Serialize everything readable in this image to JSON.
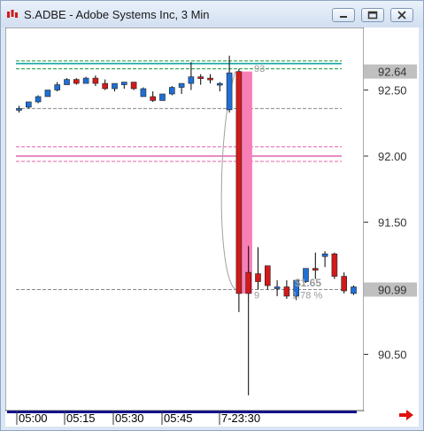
{
  "window": {
    "title": "S.ADBE - Adobe Systems Inc, 3 Min",
    "buttons": [
      "minimize",
      "restore",
      "close"
    ]
  },
  "colors": {
    "up_candle": "#1f6fd6",
    "down_candle": "#d21a1a",
    "highlight_bar": "#f77fb5",
    "teal_level": "#1aa6a6",
    "green_level": "#1a9a3a",
    "pink_level": "#e066b0",
    "gray_level": "#8a8a8a"
  },
  "icons": {
    "app": "candlestick-app-icon",
    "scroll_right": "red-right-arrow-icon"
  },
  "chart_data": {
    "type": "candlestick",
    "y_ticks": [
      "92.50",
      "92.00",
      "91.50",
      "91.00",
      "90.50"
    ],
    "x_ticks": [
      "05:00",
      "05:15",
      "05:30",
      "05:45",
      "7-23:30"
    ],
    "last_price_label": "92.64",
    "current_price_label": "90.99",
    "annotations": {
      "level_label": "93",
      "change_value": "$1.65",
      "change_percent": "1.78 %",
      "left_fragment": "9"
    },
    "candles": [
      {
        "o": 92.36,
        "h": 92.38,
        "l": 92.33,
        "c": 92.36
      },
      {
        "o": 92.37,
        "h": 92.41,
        "l": 92.36,
        "c": 92.41
      },
      {
        "o": 92.41,
        "h": 92.46,
        "l": 92.4,
        "c": 92.45
      },
      {
        "o": 92.45,
        "h": 92.5,
        "l": 92.45,
        "c": 92.5
      },
      {
        "o": 92.5,
        "h": 92.56,
        "l": 92.49,
        "c": 92.54
      },
      {
        "o": 92.54,
        "h": 92.59,
        "l": 92.54,
        "c": 92.58
      },
      {
        "o": 92.58,
        "h": 92.59,
        "l": 92.54,
        "c": 92.55
      },
      {
        "o": 92.55,
        "h": 92.6,
        "l": 92.55,
        "c": 92.59
      },
      {
        "o": 92.59,
        "h": 92.61,
        "l": 92.53,
        "c": 92.55
      },
      {
        "o": 92.55,
        "h": 92.58,
        "l": 92.5,
        "c": 92.51
      },
      {
        "o": 92.51,
        "h": 92.55,
        "l": 92.49,
        "c": 92.55
      },
      {
        "o": 92.54,
        "h": 92.56,
        "l": 92.51,
        "c": 92.56
      },
      {
        "o": 92.56,
        "h": 92.56,
        "l": 92.5,
        "c": 92.51
      },
      {
        "o": 92.45,
        "h": 92.52,
        "l": 92.45,
        "c": 92.51
      },
      {
        "o": 92.45,
        "h": 92.49,
        "l": 92.41,
        "c": 92.42
      },
      {
        "o": 92.42,
        "h": 92.47,
        "l": 92.42,
        "c": 92.47
      },
      {
        "o": 92.47,
        "h": 92.53,
        "l": 92.46,
        "c": 92.52
      },
      {
        "o": 92.52,
        "h": 92.55,
        "l": 92.47,
        "c": 92.55
      },
      {
        "o": 92.55,
        "h": 92.71,
        "l": 92.5,
        "c": 92.6
      },
      {
        "o": 92.6,
        "h": 92.62,
        "l": 92.54,
        "c": 92.59
      },
      {
        "o": 92.59,
        "h": 92.62,
        "l": 92.55,
        "c": 92.58
      },
      {
        "o": 92.54,
        "h": 92.56,
        "l": 92.49,
        "c": 92.55
      },
      {
        "o": 92.35,
        "h": 92.76,
        "l": 92.33,
        "c": 92.63
      },
      {
        "o": 92.64,
        "h": 92.66,
        "l": 90.82,
        "c": 90.96
      },
      {
        "o": 91.12,
        "h": 91.32,
        "l": 90.19,
        "c": 90.96
      },
      {
        "o": 91.11,
        "h": 91.31,
        "l": 90.99,
        "c": 91.05
      },
      {
        "o": 91.17,
        "h": 91.17,
        "l": 90.99,
        "c": 91.02
      },
      {
        "o": 91.0,
        "h": 91.06,
        "l": 90.94,
        "c": 91.01
      },
      {
        "o": 91.01,
        "h": 91.06,
        "l": 90.92,
        "c": 90.94
      },
      {
        "o": 90.94,
        "h": 91.06,
        "l": 90.91,
        "c": 91.06
      },
      {
        "o": 91.05,
        "h": 91.15,
        "l": 91.04,
        "c": 91.15
      },
      {
        "o": 91.15,
        "h": 91.27,
        "l": 91.07,
        "c": 91.14
      },
      {
        "o": 91.24,
        "h": 91.28,
        "l": 91.16,
        "c": 91.26
      },
      {
        "o": 91.26,
        "h": 91.27,
        "l": 91.07,
        "c": 91.09
      },
      {
        "o": 91.09,
        "h": 91.12,
        "l": 90.96,
        "c": 90.98
      },
      {
        "o": 90.96,
        "h": 91.02,
        "l": 90.95,
        "c": 91.01
      }
    ],
    "levels": [
      {
        "price": 92.72,
        "color": "green",
        "style": "dashed"
      },
      {
        "price": 92.7,
        "color": "teal",
        "style": "solid"
      },
      {
        "price": 92.66,
        "color": "green",
        "style": "dashed"
      },
      {
        "price": 92.36,
        "color": "gray",
        "style": "dashed"
      },
      {
        "price": 92.07,
        "color": "pink",
        "style": "dashed"
      },
      {
        "price": 92.0,
        "color": "pink",
        "style": "solid"
      },
      {
        "price": 91.96,
        "color": "pink",
        "style": "dashed"
      },
      {
        "price": 90.99,
        "color": "gray",
        "style": "dashed"
      }
    ]
  }
}
